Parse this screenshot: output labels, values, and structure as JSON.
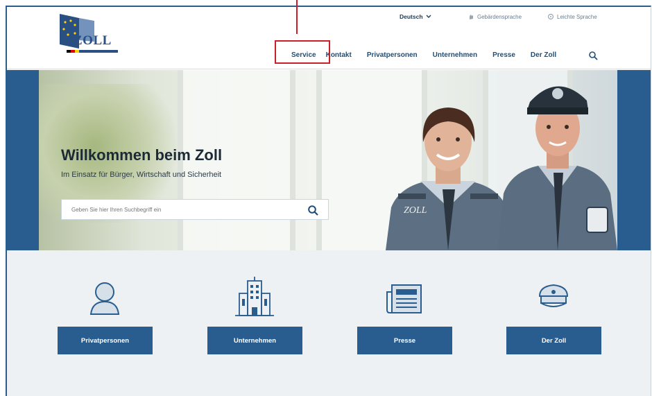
{
  "header": {
    "logo_text": "ZOLL",
    "language": "Deutsch",
    "gebaerdensprache": "Gebärdensprache",
    "leichte_sprache": "Leichte Sprache",
    "nav": [
      "Service",
      "Kontakt",
      "Privatpersonen",
      "Unternehmen",
      "Presse",
      "Der Zoll"
    ]
  },
  "hero": {
    "title": "Willkommen beim Zoll",
    "subtitle": "Im Einsatz für Bürger, Wirtschaft und Sicherheit",
    "search_placeholder": "Geben Sie hier Ihren Suchbegriff ein",
    "jacket_text": "ZOLL"
  },
  "tiles": [
    {
      "label": "Privatpersonen",
      "icon": "person-icon"
    },
    {
      "label": "Unternehmen",
      "icon": "building-icon"
    },
    {
      "label": "Presse",
      "icon": "newspaper-icon"
    },
    {
      "label": "Der Zoll",
      "icon": "cap-icon"
    }
  ],
  "colors": {
    "primary": "#2a5d8f",
    "highlight": "#c7202a",
    "section_bg": "#edf1f4"
  }
}
